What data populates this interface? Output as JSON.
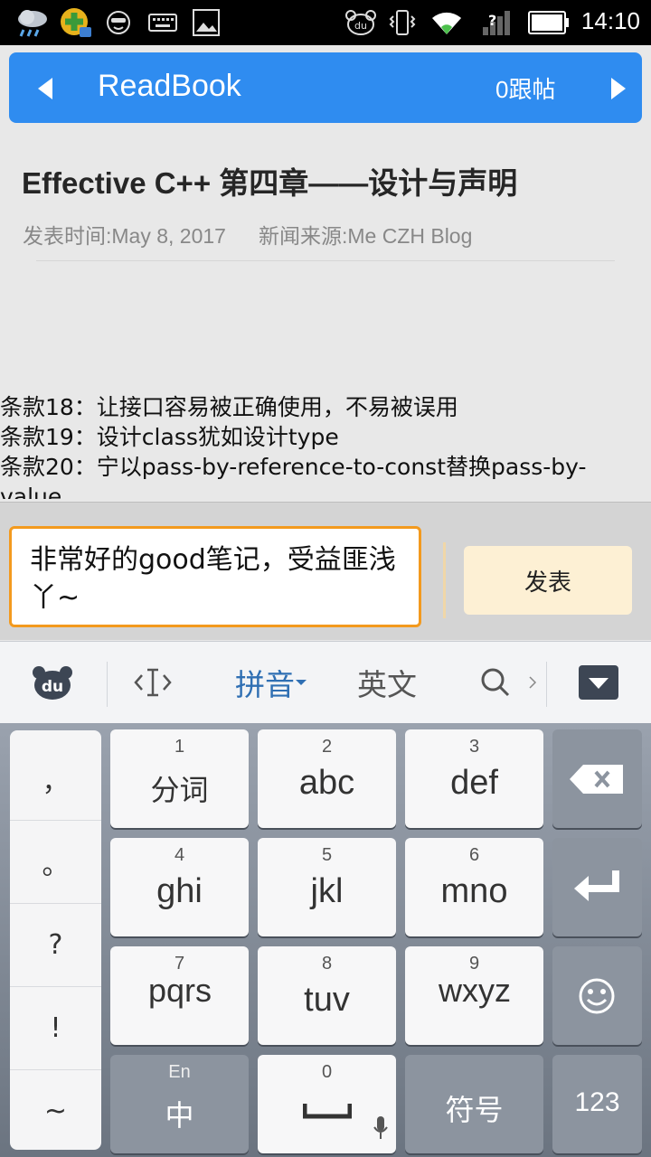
{
  "status_bar": {
    "time": "14:10",
    "icons": [
      "weather-rain-icon",
      "app-notification-icon",
      "smiley-icon",
      "keyboard-icon",
      "image-icon",
      "du-icon",
      "vibrate-icon",
      "wifi-icon",
      "signal-icon",
      "battery-icon"
    ]
  },
  "header": {
    "title": "ReadBook",
    "reply_count": "0跟帖"
  },
  "article": {
    "title": "Effective C++ 第四章——设计与声明",
    "published": "发表时间:May 8, 2017",
    "source": "新闻来源:Me CZH Blog",
    "body_lines": [
      "条款18：让接口容易被正确使用，不易被误用",
      "条款19：设计class犹如设计type",
      "条款20：宁以pass-by-reference-to-const替换pass-by-",
      "value"
    ]
  },
  "comment": {
    "value": "非常好的good笔记，受益匪浅丫~",
    "post_label": "发表"
  },
  "ime_toolbar": {
    "pinyin_label": "拼音",
    "english_label": "英文"
  },
  "keyboard": {
    "punctuation": [
      "，",
      "。",
      "?",
      "!",
      "~"
    ],
    "keys": [
      {
        "num": "1",
        "label": "分词"
      },
      {
        "num": "2",
        "label": "abc"
      },
      {
        "num": "3",
        "label": "def"
      },
      {
        "num": "4",
        "label": "ghi"
      },
      {
        "num": "5",
        "label": "jkl"
      },
      {
        "num": "6",
        "label": "mno"
      },
      {
        "num": "7",
        "label": "pqrs"
      },
      {
        "num": "8",
        "label": "tuv"
      },
      {
        "num": "9",
        "label": "wxyz"
      }
    ],
    "lang_switch": {
      "top": "En",
      "label": "中"
    },
    "space_num": "0",
    "symbols_label": "符号",
    "numbers_label": "123"
  },
  "colors": {
    "header_blue": "#2f8cf0",
    "input_border": "#f39a1e",
    "post_button_bg": "#fdf0d4"
  }
}
